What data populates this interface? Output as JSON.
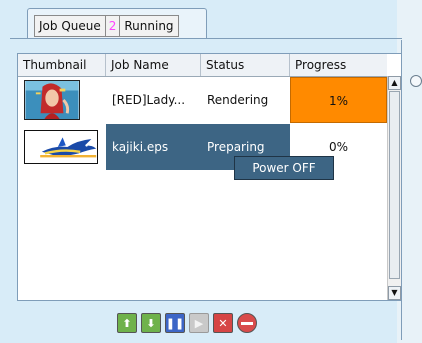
{
  "tabs": {
    "job_queue_label": "Job Queue",
    "count": "2",
    "running_label": "Running"
  },
  "table": {
    "columns": [
      "Thumbnail",
      "Job Name",
      "Status",
      "Progress"
    ],
    "rows": [
      {
        "name": "[RED]Lady...",
        "status": "Rendering",
        "progress": "1%",
        "progress_fraction": 0.01
      },
      {
        "name": "kajiki.eps",
        "status": "Preparing",
        "progress": "0%",
        "progress_fraction": 0.0
      }
    ]
  },
  "context_menu": {
    "items": [
      "Power OFF"
    ]
  },
  "toolbar": {
    "buttons": [
      {
        "name": "move-up-button",
        "icon": "up-arrow-icon",
        "color": "#6fb24b"
      },
      {
        "name": "move-down-button",
        "icon": "down-arrow-icon",
        "color": "#6fb24b"
      },
      {
        "name": "pause-button",
        "icon": "pause-icon",
        "color": "#3d66c7"
      },
      {
        "name": "resume-button",
        "icon": "play-icon",
        "color": "#c9c9c9"
      },
      {
        "name": "delete-button",
        "icon": "x-icon",
        "color": "#d64545"
      },
      {
        "name": "stop-button",
        "icon": "no-entry-icon",
        "color": "#d94b4b"
      }
    ]
  },
  "colors": {
    "accent_selection": "#3d6584",
    "progress_active": "#ff8a00",
    "tab_count": "#ff44ff"
  }
}
